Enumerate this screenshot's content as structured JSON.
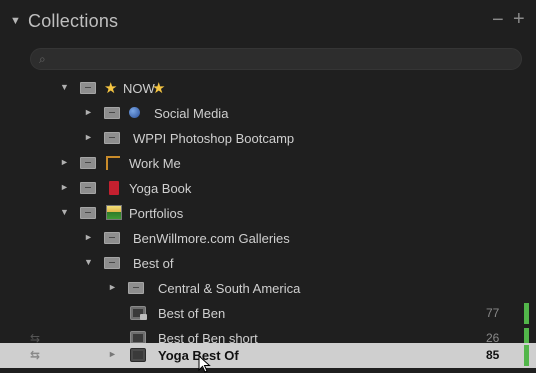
{
  "panel": {
    "title": "Collections",
    "minus_label": "−",
    "plus_label": "+",
    "filter_placeholder": "",
    "filter_icon": "search-icon"
  },
  "tree": {
    "items": [
      {
        "label": "NOW",
        "icon": "star-icon",
        "count": "",
        "disclosure": "open"
      },
      {
        "label": "Social Media",
        "icon": "globe-icon",
        "count": "",
        "disclosure": "closed"
      },
      {
        "label": "WPPI Photoshop Bootcamp",
        "icon": "collection-set-icon",
        "count": "",
        "disclosure": "closed"
      },
      {
        "label": "Work Me",
        "icon": "frame-icon",
        "count": "",
        "disclosure": "closed"
      },
      {
        "label": "Yoga Book",
        "icon": "book-icon",
        "count": "",
        "disclosure": "closed"
      },
      {
        "label": "Portfolios",
        "icon": "portfolio-icon",
        "count": "",
        "disclosure": "open"
      },
      {
        "label": "BenWillmore.com Galleries",
        "icon": "collection-set-icon",
        "count": "",
        "disclosure": "closed"
      },
      {
        "label": "Best of",
        "icon": "collection-set-icon",
        "count": "",
        "disclosure": "open"
      },
      {
        "label": "Central & South America",
        "icon": "collection-set-icon",
        "count": "",
        "disclosure": "closed"
      },
      {
        "label": "Best of Ben",
        "icon": "smart-collection-icon",
        "count": "77",
        "disclosure": ""
      },
      {
        "label": "Best of Ben short",
        "icon": "collection-icon",
        "count": "26",
        "disclosure": ""
      },
      {
        "label": "Yoga Best Of",
        "icon": "collection-icon",
        "count": "85",
        "disclosure": "closed",
        "selected": true
      }
    ]
  },
  "colors": {
    "background": "#1f1f1f",
    "selected_row": "#cfcfcf",
    "target_marker": "#52b64a"
  }
}
